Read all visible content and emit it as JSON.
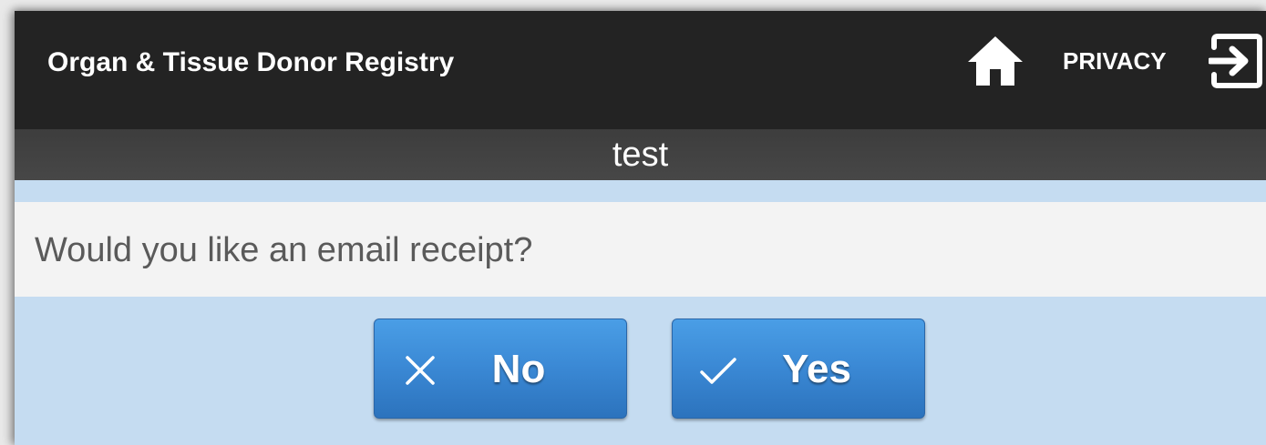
{
  "header": {
    "app_title": "Organ & Tissue Donor Registry",
    "home_icon": "home-icon",
    "privacy_label": "PRIVACY",
    "logout_icon": "logout-icon"
  },
  "subheader": {
    "title": "test"
  },
  "prompt": {
    "question": "Would you like an email receipt?"
  },
  "actions": {
    "no_label": "No",
    "no_icon": "close-icon",
    "yes_label": "Yes",
    "yes_icon": "check-icon"
  },
  "colors": {
    "header_bg": "#232323",
    "subheader_bg": "#434343",
    "page_bg": "#c5dcf1",
    "question_bg": "#f3f3f3",
    "button_blue": "#3a88d4"
  }
}
